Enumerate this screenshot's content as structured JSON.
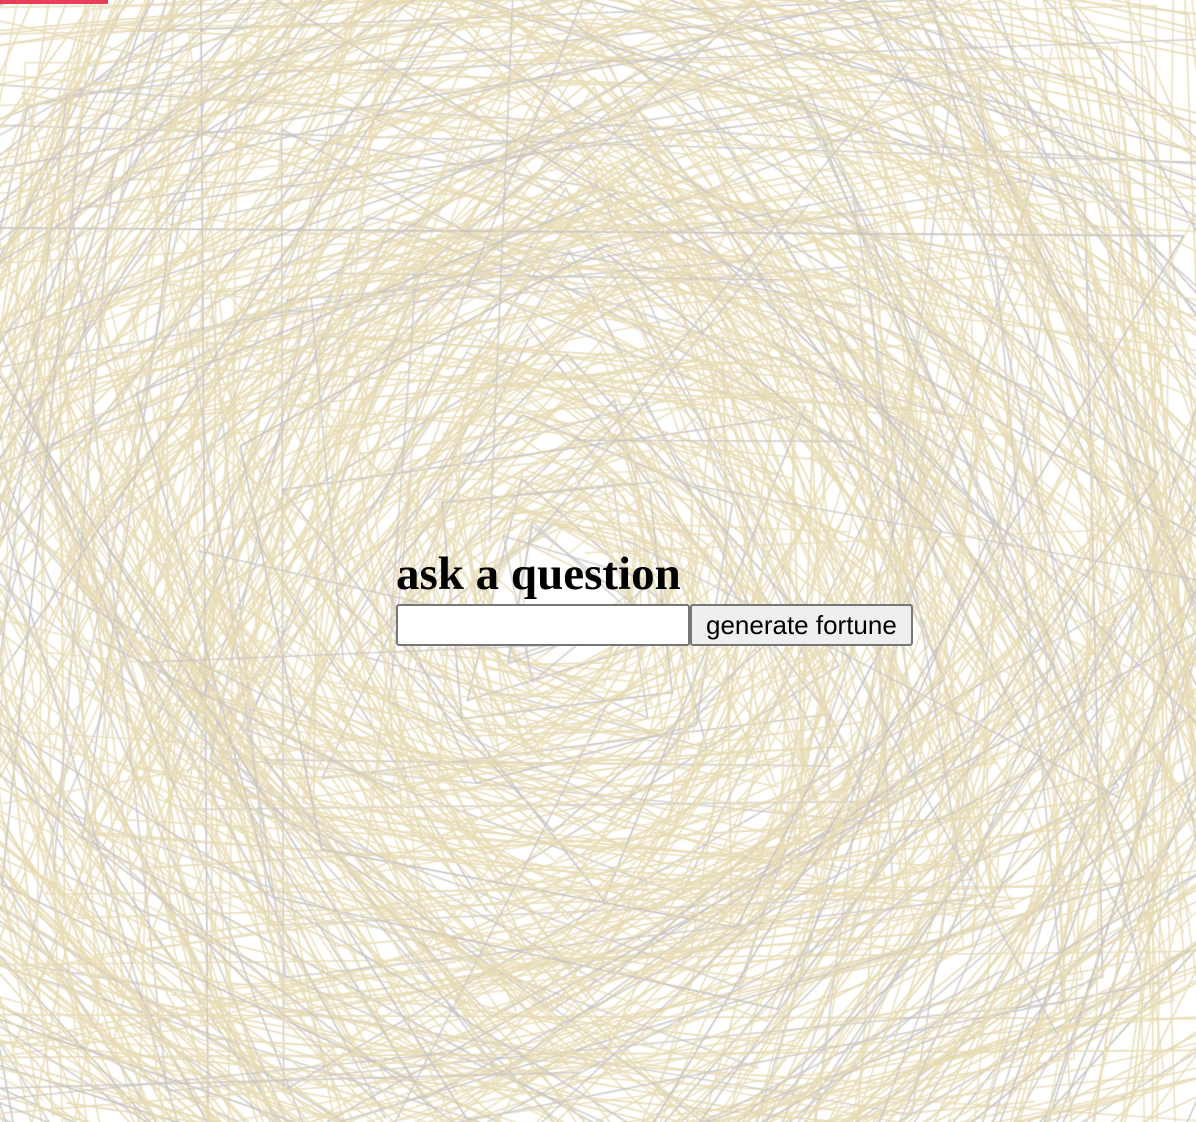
{
  "form": {
    "title": "ask a question",
    "question_value": "",
    "question_placeholder": "",
    "submit_label": "generate fortune"
  },
  "colors": {
    "background": "#ffffff",
    "line_primary": "#e8dcb5",
    "line_secondary": "#c9c4c4",
    "accent": "#e8405a"
  }
}
